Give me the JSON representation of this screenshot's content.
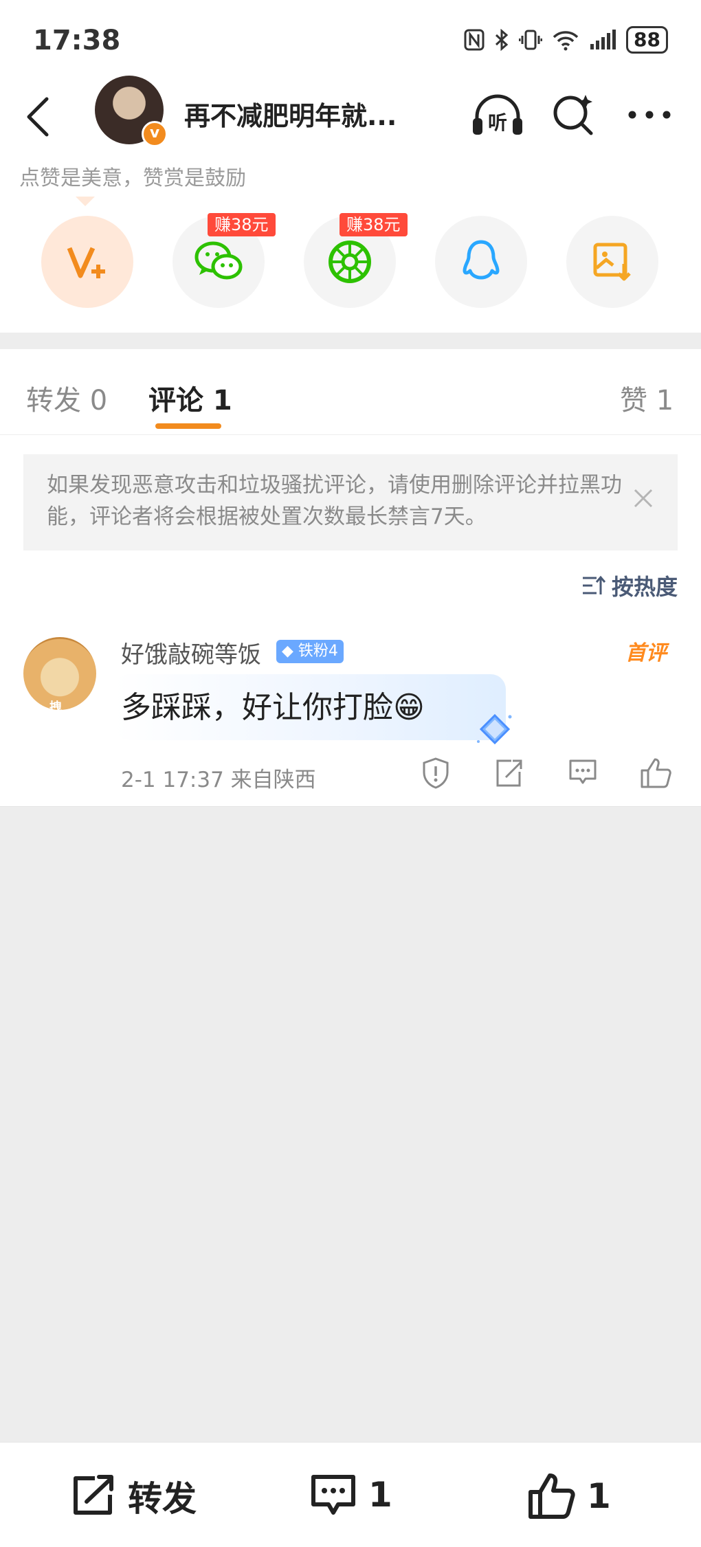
{
  "status_bar": {
    "time": "17:38",
    "battery": "88"
  },
  "header": {
    "title": "再不减肥明年就..."
  },
  "share": {
    "tooltip": "点赞是美意，赞赏是鼓励",
    "reward_badges": [
      "赚38元",
      "赚38元"
    ],
    "icons": [
      "vip-plus-icon",
      "wechat-icon",
      "moments-icon",
      "qq-icon",
      "save-image-icon"
    ],
    "colors": {
      "vip": "#f28b1e",
      "wechat": "#2dc100",
      "qq": "#29a7ff",
      "save": "#f5a623"
    }
  },
  "tabs": [
    {
      "label": "转发 0"
    },
    {
      "label": "评论 1"
    },
    {
      "label": "赞 1"
    }
  ],
  "notice": {
    "text": "如果发现恶意攻击和垃圾骚扰评论，请使用删除评论并拉黑功能，评论者将会根据被处置次数最长禁言7天。"
  },
  "sort": {
    "label": "按热度"
  },
  "comment": {
    "avatar_tag": "拽",
    "username": "好饿敲碗等饭",
    "fan_badge": "铁粉4",
    "first_tag": "首评",
    "text": "多踩踩，好让你打脸😁",
    "meta": "2-1 17:37  来自陕西"
  },
  "bottom_bar": {
    "repost_label": "转发",
    "comment_count": "1",
    "like_count": "1"
  },
  "accent_color": "#f28b1e"
}
